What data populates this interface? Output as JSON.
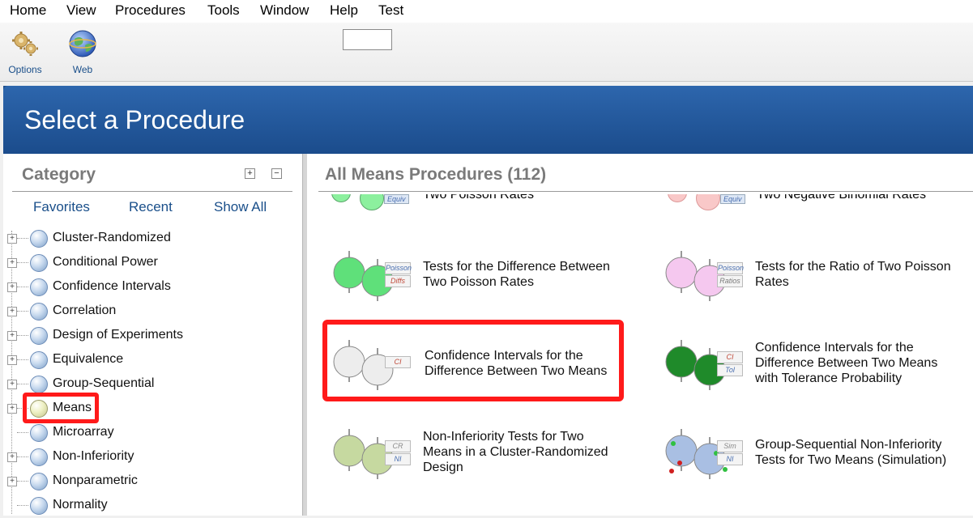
{
  "menu": [
    "Home",
    "View",
    "Procedures",
    "Tools",
    "Window",
    "Help",
    "Test"
  ],
  "toolbar": {
    "options_label": "Options",
    "web_label": "Web",
    "input_value": ""
  },
  "banner": {
    "title": "Select a Procedure"
  },
  "category": {
    "title": "Category",
    "expand_all": "+",
    "collapse_all": "−",
    "tabs": [
      "Favorites",
      "Recent",
      "Show All"
    ],
    "items": [
      {
        "label": "Cluster-Randomized",
        "expandable": true
      },
      {
        "label": "Conditional Power",
        "expandable": true
      },
      {
        "label": "Confidence Intervals",
        "expandable": true
      },
      {
        "label": "Correlation",
        "expandable": true
      },
      {
        "label": "Design of Experiments",
        "expandable": true
      },
      {
        "label": "Equivalence",
        "expandable": true
      },
      {
        "label": "Group-Sequential",
        "expandable": true
      },
      {
        "label": "Means",
        "expandable": true,
        "selected": true
      },
      {
        "label": "Microarray",
        "expandable": false
      },
      {
        "label": "Non-Inferiority",
        "expandable": true
      },
      {
        "label": "Nonparametric",
        "expandable": true
      },
      {
        "label": "Normality",
        "expandable": false
      }
    ]
  },
  "procedures": {
    "title": "All Means Procedures (112)",
    "items": [
      {
        "line1": "Tests for the Difference Between",
        "line2": "Two Poisson Rates",
        "line3": "",
        "tag1": "Poisson",
        "tag2": "Diffs",
        "color": "#5fe07a",
        "tag1_color": "#4a6fb0",
        "tag2_color": "#c04a3a"
      },
      {
        "line1": "Tests for the Ratio of Two Poisson",
        "line2": "Rates",
        "line3": "",
        "tag1": "Poisson",
        "tag2": "Ratios",
        "color": "#f5c8ef",
        "tag1_color": "#4a6fb0",
        "tag2_color": "#7a7a7a"
      },
      {
        "line1": "Confidence Intervals for the",
        "line2": "Difference Between Two Means",
        "line3": "",
        "tag1": "CI",
        "tag2": "",
        "color": "#ededed",
        "tag1_color": "#c04a3a",
        "tag2_color": ""
      },
      {
        "line1": "Confidence Intervals for the",
        "line2": "Difference Between Two Means",
        "line3": "with Tolerance Probability",
        "tag1": "CI",
        "tag2": "Tol",
        "color": "#1f8a2a",
        "tag1_color": "#c04a3a",
        "tag2_color": "#4a6fb0"
      },
      {
        "line1": "Non-Inferiority Tests for Two",
        "line2": "Means in a Cluster-Randomized",
        "line3": "Design",
        "tag1": "CR",
        "tag2": "NI",
        "color": "#c6d9a0",
        "tag1_color": "#8a8a8a",
        "tag2_color": "#4a6fb0"
      },
      {
        "line1": "Group-Sequential Non-Inferiority",
        "line2": "Tests for Two Means (Simulation)",
        "line3": "",
        "tag1": "Sim",
        "tag2": "NI",
        "color": "#a9bfe3",
        "tag1_color": "#8a8a8a",
        "tag2_color": "#4a6fb0"
      }
    ],
    "partial_top": [
      "Two Poisson Rates",
      "Two Negative Binomial Rates"
    ],
    "partial_tags": [
      "Equiv",
      "Equiv"
    ]
  }
}
